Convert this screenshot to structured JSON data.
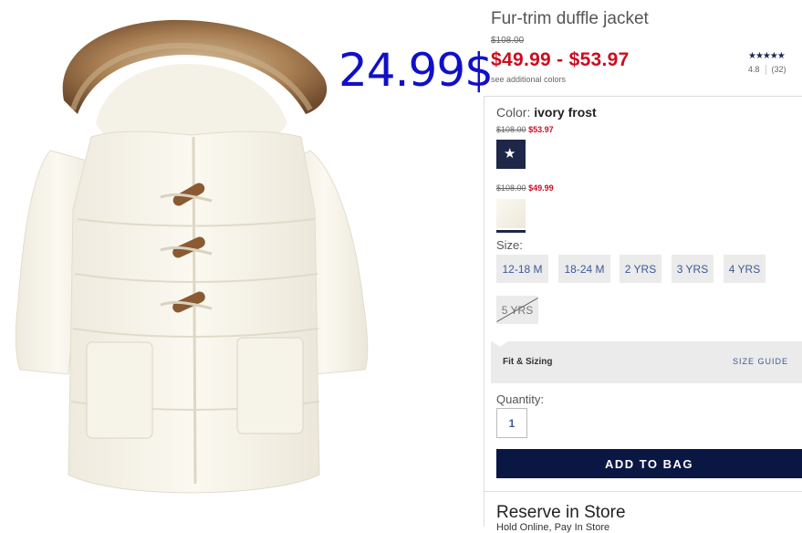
{
  "overlay": {
    "handwritten_price": "24.99$"
  },
  "product": {
    "title": "Fur-trim duffle jacket",
    "original_price": "$108.00",
    "sale_price": "$49.99 - $53.97",
    "see_colors": "see additional colors",
    "rating": {
      "stars": "★★★★★",
      "score": "4.8",
      "count": "(32)"
    }
  },
  "color": {
    "label": "Color:",
    "selected": "ivory frost",
    "swatches": [
      {
        "orig": "$108.00",
        "sale": "$53.97",
        "color": "#1e2748",
        "icon": "star-icon"
      },
      {
        "orig": "$108.00",
        "sale": "$49.99",
        "color": "#f6f3e8"
      }
    ]
  },
  "size": {
    "label": "Size:",
    "options": [
      "12-18 M",
      "18-24 M",
      "2 YRS",
      "3 YRS",
      "4 YRS",
      "5 YRS"
    ],
    "unavailable": [
      "5 YRS"
    ]
  },
  "fit": {
    "label": "Fit & Sizing",
    "guide": "SIZE GUIDE"
  },
  "quantity": {
    "label": "Quantity:",
    "value": "1"
  },
  "cart": {
    "add_label": "ADD TO BAG"
  },
  "store": {
    "title": "Reserve in Store",
    "sub": "Hold Online, Pay In Store"
  },
  "colors": {
    "sale_red": "#cc0c1f",
    "navy": "#0b1743",
    "link_blue": "#3c5a95",
    "overlay_blue": "#1010c8"
  }
}
